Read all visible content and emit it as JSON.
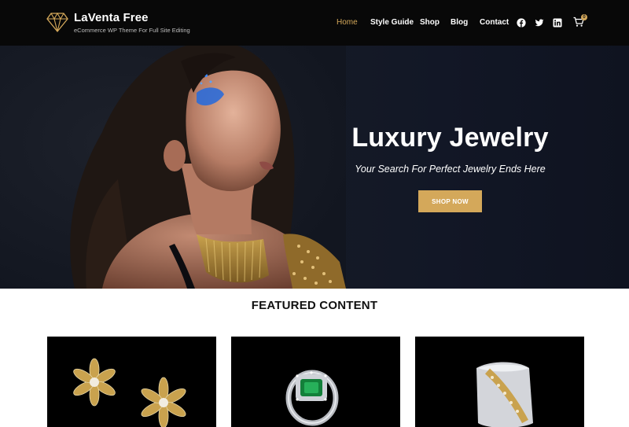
{
  "brand": {
    "name": "LaVenta Free",
    "tagline": "eCommerce WP Theme For Full Site Editing",
    "logo_icon": "diamond-icon"
  },
  "nav": {
    "items": [
      {
        "label": "Home",
        "active": true
      },
      {
        "label": "Style Guide",
        "active": false
      },
      {
        "label": "Shop",
        "active": false
      },
      {
        "label": "Blog",
        "active": false
      },
      {
        "label": "Contact",
        "active": false
      }
    ],
    "social": [
      "facebook-icon",
      "twitter-icon",
      "linkedin-icon"
    ],
    "cart": {
      "icon": "cart-icon",
      "count": "0"
    }
  },
  "hero": {
    "title": "Luxury Jewelry",
    "subtitle": "Your Search For Perfect Jewelry Ends Here",
    "button": "SHOP NOW"
  },
  "featured": {
    "heading": "FEATURED CONTENT",
    "cards": [
      {
        "image": "flower-earrings-image"
      },
      {
        "image": "emerald-ring-image"
      },
      {
        "image": "diamond-bracelet-image"
      }
    ]
  },
  "colors": {
    "accent": "#d4a85a",
    "header_bg": "#080808",
    "hero_bg": "#141821",
    "card_bg": "#000000"
  }
}
